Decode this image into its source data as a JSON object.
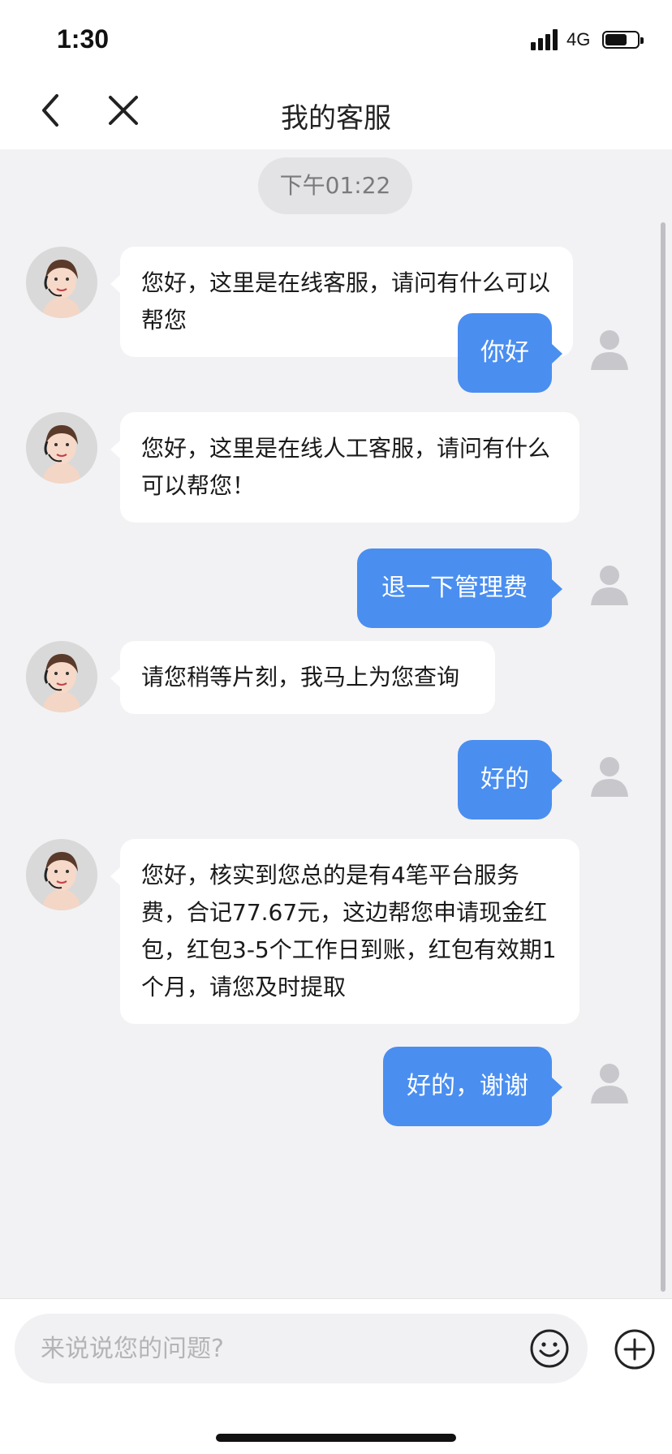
{
  "status_bar": {
    "time": "1:30",
    "network": "4G"
  },
  "nav": {
    "title": "我的客服"
  },
  "chat": {
    "timestamp": "下午01:22",
    "messages": [
      {
        "from": "agent",
        "text": "您好，这里是在线客服，请问有什么可以帮您"
      },
      {
        "from": "user",
        "text": "你好"
      },
      {
        "from": "agent",
        "text": "您好，这里是在线人工客服，请问有什么可以帮您！"
      },
      {
        "from": "user",
        "text": "退一下管理费"
      },
      {
        "from": "agent",
        "text": "请您稍等片刻，我马上为您查询"
      },
      {
        "from": "user",
        "text": "好的"
      },
      {
        "from": "agent",
        "text": "您好，核实到您总的是有4笔平台服务费，合记77.67元，这边帮您申请现金红包，红包3-5个工作日到账，红包有效期1个月，请您及时提取"
      },
      {
        "from": "user",
        "text": "好的，谢谢"
      }
    ]
  },
  "input": {
    "placeholder": "来说说您的问题?",
    "value": ""
  },
  "icons": {
    "back": "chevron-left-icon",
    "close": "close-icon",
    "emoji": "smiley-icon",
    "plus": "plus-circle-icon",
    "agent_avatar": "agent-avatar",
    "user_avatar": "user-placeholder-icon"
  },
  "colors": {
    "accent": "#4a8ef0",
    "background": "#f2f2f4",
    "incoming_bubble": "#ffffff"
  }
}
